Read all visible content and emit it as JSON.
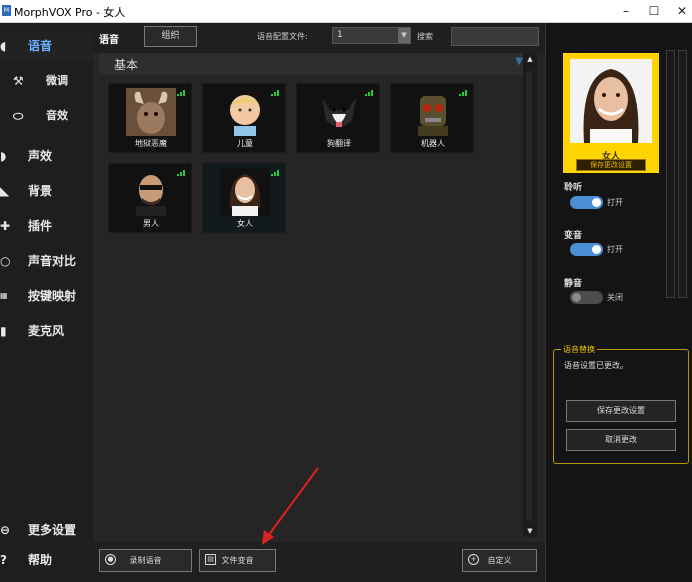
{
  "window": {
    "title": "MorphVOX Pro - 女人",
    "icon_label": "M",
    "minimize": "–",
    "maximize": "☐",
    "close": "✕"
  },
  "sidebar": {
    "items": [
      {
        "label": "语音",
        "icon": "voice-icon"
      },
      {
        "label": "微调",
        "icon": "tools-icon"
      },
      {
        "label": "音效",
        "icon": "lips-icon"
      },
      {
        "label": "声效",
        "icon": "sound-icon"
      },
      {
        "label": "背景",
        "icon": "background-icon"
      },
      {
        "label": "插件",
        "icon": "plugin-icon"
      },
      {
        "label": "声音对比",
        "icon": "compare-icon"
      },
      {
        "label": "按键映射",
        "icon": "keyboard-icon"
      },
      {
        "label": "麦克风",
        "icon": "mic-icon"
      }
    ],
    "more_settings": "更多设置",
    "help": "帮助"
  },
  "toolbar": {
    "voice_tab": "语音",
    "group_button": "组织",
    "profile_label": "语音配置文件:",
    "profile_value": "1",
    "search_label": "搜索"
  },
  "voices": {
    "section": "基本",
    "items": [
      {
        "name": "地狱恶魔"
      },
      {
        "name": "儿童"
      },
      {
        "name": "狗翻译"
      },
      {
        "name": "机器人"
      },
      {
        "name": "男人"
      },
      {
        "name": "女人",
        "selected": true
      }
    ]
  },
  "bottom": {
    "record": "录制语音",
    "file_morph": "文件变音",
    "custom": "自定义"
  },
  "right": {
    "current_voice": "女人",
    "save_changes_small": "保存更改设置",
    "listen_label": "聆听",
    "listen_state": "打开",
    "listen_on": true,
    "morph_label": "变音",
    "morph_state": "打开",
    "morph_on": true,
    "mute_label": "静音",
    "mute_state": "关闭",
    "mute_on": false,
    "replace_title": "语音替换",
    "replace_msg": "语音设置已更改。",
    "save_btn": "保存更改设置",
    "cancel_btn": "取消更改"
  },
  "colors": {
    "accent_blue": "#4a8fd6",
    "gold": "#ffd400",
    "arrow_red": "#e02020",
    "signal_green": "#27c93f"
  }
}
